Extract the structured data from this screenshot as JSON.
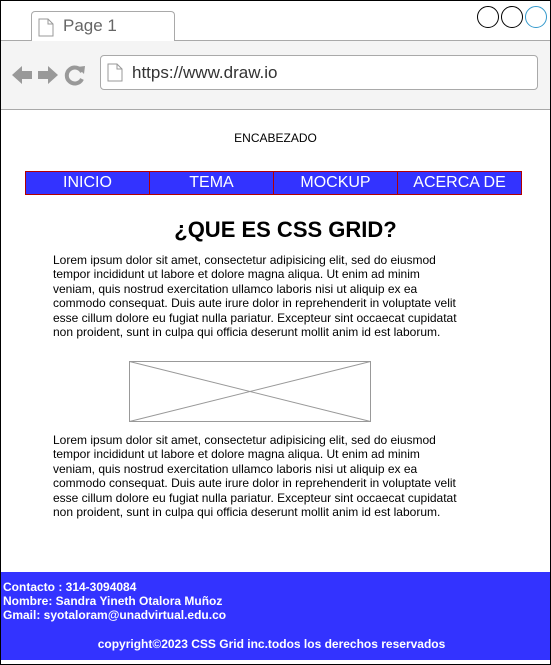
{
  "browser": {
    "tab_title": "Page 1",
    "url": "https://www.draw.io",
    "icons": [
      "page-icon",
      "back-arrow-icon",
      "forward-arrow-icon",
      "reload-icon"
    ]
  },
  "page": {
    "header": "ENCABEZADO",
    "menu": [
      {
        "label": "INICIO"
      },
      {
        "label": "TEMA"
      },
      {
        "label": "MOCKUP"
      },
      {
        "label": "ACERCA DE"
      }
    ],
    "title": "¿QUE ES CSS GRID?",
    "paragraph1": "Lorem ipsum dolor sit amet, consectetur adipisicing elit, sed do eiusmod tempor incididunt ut labore et dolore magna aliqua. Ut enim ad minim veniam, quis nostrud exercitation ullamco laboris nisi ut aliquip ex ea commodo consequat. Duis aute irure dolor in reprehenderit in voluptate velit esse cillum dolore eu fugiat nulla pariatur. Excepteur sint occaecat cupidatat non proident, sunt in culpa qui officia deserunt mollit anim id est laborum.",
    "paragraph2": "Lorem ipsum dolor sit amet, consectetur adipisicing elit, sed do eiusmod tempor incididunt ut labore et dolore magna aliqua. Ut enim ad minim veniam, quis nostrud exercitation ullamco laboris nisi ut aliquip ex ea commodo consequat. Duis aute irure dolor in reprehenderit in voluptate velit esse cillum dolore eu fugiat nulla pariatur. Excepteur sint occaecat cupidatat non proident, sunt in culpa qui officia deserunt mollit anim id est laborum."
  },
  "footer": {
    "contact": "Contacto : 314-3094084",
    "name": "Nombre: Sandra Yineth Otalora Muñoz",
    "email": "Gmail: syotaloram@unadvirtual.edu.co",
    "copyright": "copyright©2023 CSS Grid inc.todos los derechos reservados"
  },
  "colors": {
    "menu_bg": "#3333ff",
    "menu_border": "#b20000",
    "footer_bg": "#3333ff",
    "active_window_button": "#3399cc"
  }
}
